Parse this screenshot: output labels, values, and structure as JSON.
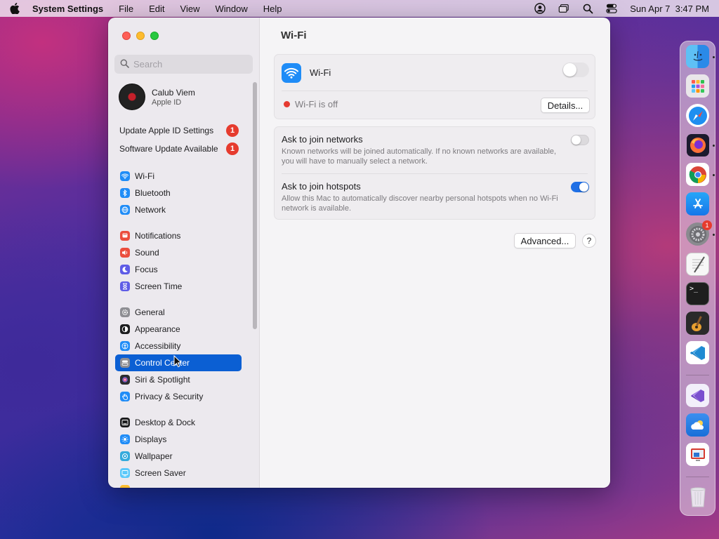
{
  "menubar": {
    "app_name": "System Settings",
    "menus": [
      "File",
      "Edit",
      "View",
      "Window",
      "Help"
    ],
    "datetime": "Sun Apr 7  3:47 PM"
  },
  "sidebar": {
    "search_placeholder": "Search",
    "account": {
      "name": "Calub Viem",
      "subtitle": "Apple ID"
    },
    "alerts": [
      {
        "label": "Update Apple ID Settings",
        "count": "1"
      },
      {
        "label": "Software Update Available",
        "count": "1"
      }
    ],
    "items": [
      {
        "label": "Wi-Fi",
        "icon": "wifi-icon",
        "color": "#1f8cf7"
      },
      {
        "label": "Bluetooth",
        "icon": "bluetooth-icon",
        "color": "#1f8cf7"
      },
      {
        "label": "Network",
        "icon": "globe-icon",
        "color": "#1f8cf7"
      },
      {
        "label": "Notifications",
        "icon": "bell-icon",
        "color": "#eb4d3d"
      },
      {
        "label": "Sound",
        "icon": "speaker-icon",
        "color": "#eb4d3d"
      },
      {
        "label": "Focus",
        "icon": "moon-icon",
        "color": "#5e5ce6"
      },
      {
        "label": "Screen Time",
        "icon": "hourglass-icon",
        "color": "#5e5ce6"
      },
      {
        "label": "General",
        "icon": "gear-icon",
        "color": "#8e8e93"
      },
      {
        "label": "Appearance",
        "icon": "appearance-icon",
        "color": "#1c1c1e"
      },
      {
        "label": "Accessibility",
        "icon": "accessibility-icon",
        "color": "#1f8cf7"
      },
      {
        "label": "Control Center",
        "icon": "control-center-icon",
        "color": "#8e8e93"
      },
      {
        "label": "Siri & Spotlight",
        "icon": "siri-icon",
        "color": "#2c2c2e"
      },
      {
        "label": "Privacy & Security",
        "icon": "hand-icon",
        "color": "#1f8cf7"
      },
      {
        "label": "Desktop & Dock",
        "icon": "dock-icon",
        "color": "#1c1c1e"
      },
      {
        "label": "Displays",
        "icon": "sun-icon",
        "color": "#1f8cf7"
      },
      {
        "label": "Wallpaper",
        "icon": "wallpaper-icon",
        "color": "#34aadc"
      },
      {
        "label": "Screen Saver",
        "icon": "screensaver-icon",
        "color": "#5ac8fa"
      }
    ],
    "selected": "Control Center"
  },
  "content": {
    "title": "Wi-Fi",
    "wifi_card": {
      "label": "Wi-Fi",
      "status": "Wi-Fi is off",
      "status_color": "#e53a30",
      "details_button": "Details...",
      "enabled": false
    },
    "options": [
      {
        "title": "Ask to join networks",
        "description": "Known networks will be joined automatically. If no known networks are available, you will have to manually select a network.",
        "enabled": false
      },
      {
        "title": "Ask to join hotspots",
        "description": "Allow this Mac to automatically discover nearby personal hotspots when no Wi-Fi network is available.",
        "enabled": true
      }
    ],
    "advanced_button": "Advanced...",
    "help_button": "?"
  },
  "dock": {
    "apps": [
      "Finder",
      "Launchpad",
      "Safari",
      "Firefox",
      "Chrome",
      "App Store",
      "System Settings",
      "TextEdit",
      "Terminal",
      "GarageBand",
      "Visual Studio Code",
      "Visual Studio",
      "Weather",
      "Remote Desktop",
      "Trash"
    ],
    "system_settings_badge": "1",
    "terminal_label": ">_"
  },
  "colors": {
    "accent": "#0b5fd3",
    "badge": "#e63b2e"
  }
}
